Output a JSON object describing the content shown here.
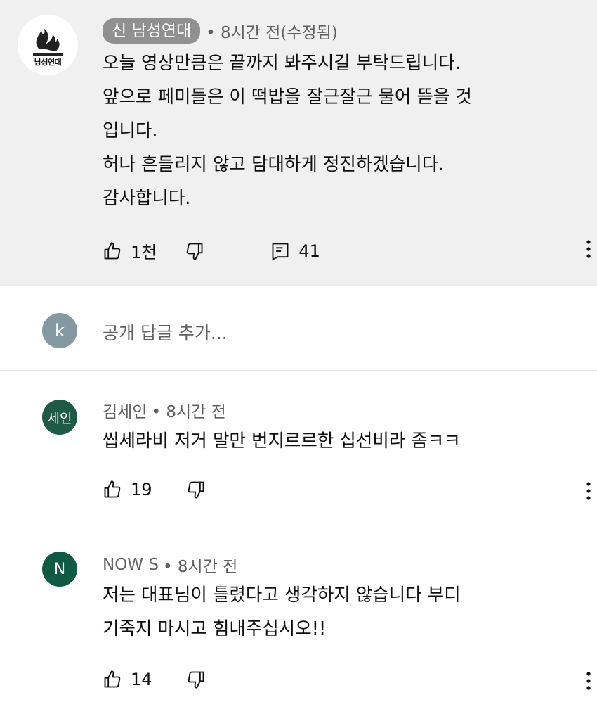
{
  "pinned_comment": {
    "author": "신 남성연대",
    "meta": "• 8시간 전(수정됨)",
    "avatar_text": "남성연대",
    "lines": [
      "오늘 영상만큼은 끝까지 봐주시길 부탁드립니다.",
      "앞으로 페미들은 이 떡밥을 잘근잘근 물어 뜯을 것",
      "입니다.",
      "허나 흔들리지 않고 담대하게 정진하겠습니다.",
      "감사합니다."
    ],
    "likes": "1천",
    "replies": "41"
  },
  "reply_box": {
    "avatar_letter": "k",
    "placeholder": "공개 답글 추가..."
  },
  "comments": [
    {
      "author": "김세인",
      "meta": "• 8시간 전",
      "avatar_text": "세인",
      "avatar_color": "#1e5a45",
      "lines": [
        "씹세라비 저거 말만 번지르르한 십선비라 좀ㅋㅋ"
      ],
      "likes": "19"
    },
    {
      "author": "NOW S",
      "meta": "• 8시간 전",
      "avatar_text": "N",
      "avatar_color": "#0e5a43",
      "lines": [
        "저는 대표님이 틀렸다고 생각하지 않습니다 부디",
        "기죽지 마시고 힘내주십시오!!"
      ],
      "likes": "14"
    }
  ],
  "icons": {
    "like": "thumbs-up-icon",
    "dislike": "thumbs-down-icon",
    "reply": "comment-icon",
    "more": "more-vert-icon"
  }
}
